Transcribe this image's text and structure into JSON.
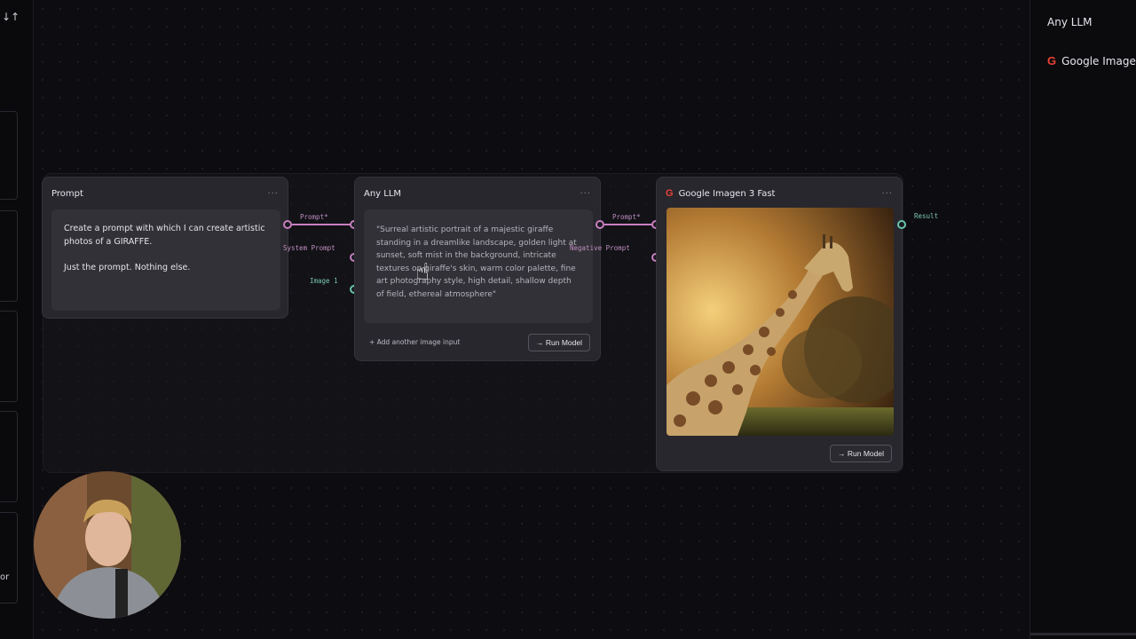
{
  "toolbar": {
    "sort_icon": "sort-arrows-icon",
    "partial_label": "or"
  },
  "nodes": {
    "prompt": {
      "title": "Prompt",
      "menu": "···",
      "text_line1": "Create a prompt with which I can create artistic photos of a GIRAFFE.",
      "text_line2": "Just the prompt. Nothing else."
    },
    "llm": {
      "title": "Any LLM",
      "menu": "···",
      "output": "\"Surreal artistic portrait of a majestic giraffe standing in a dreamlike landscape, golden light at sunset, soft mist in the background, intricate textures on giraffe's skin, warm color palette, fine art photography style, high detail, shallow depth of field, ethereal atmosphere\"",
      "add_input": "+ Add another image input",
      "run": "→ Run Model",
      "ports": {
        "prompt": "Prompt*",
        "system_prompt": "System Prompt",
        "image": "Image 1"
      }
    },
    "imagen": {
      "title": "Google Imagen 3 Fast",
      "menu": "···",
      "run": "→ Run Model",
      "ports": {
        "prompt": "Prompt*",
        "negative_prompt": "Negative Prompt",
        "result": "Result"
      }
    }
  },
  "right_panel": {
    "title": "Any LLM",
    "item": "Google Image"
  },
  "colors": {
    "port_pink": "#c77fbf",
    "port_green": "#67c5a7",
    "google_red": "#ea4335"
  }
}
